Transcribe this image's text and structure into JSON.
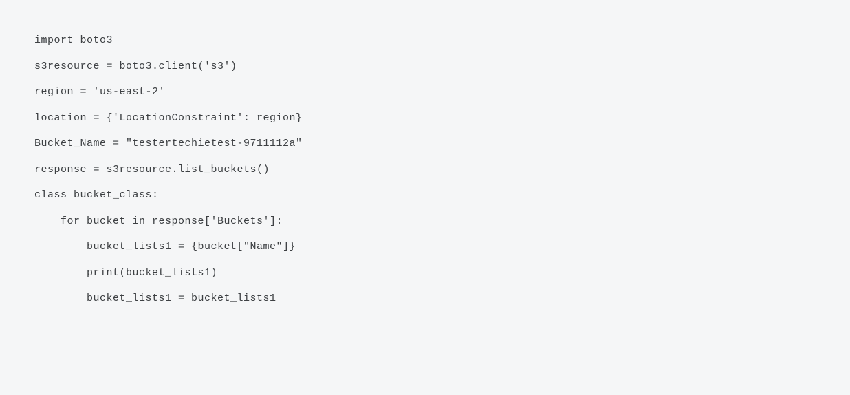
{
  "code": {
    "lines": [
      "import boto3",
      "s3resource = boto3.client('s3')",
      "region = 'us-east-2'",
      "location = {'LocationConstraint': region}",
      "Bucket_Name = \"testertechietest-9711112a\"",
      "response = s3resource.list_buckets()",
      "",
      "class bucket_class:",
      "    for bucket in response['Buckets']:",
      "        bucket_lists1 = {bucket[\"Name\"]}",
      "        print(bucket_lists1)",
      "        bucket_lists1 = bucket_lists1"
    ]
  }
}
